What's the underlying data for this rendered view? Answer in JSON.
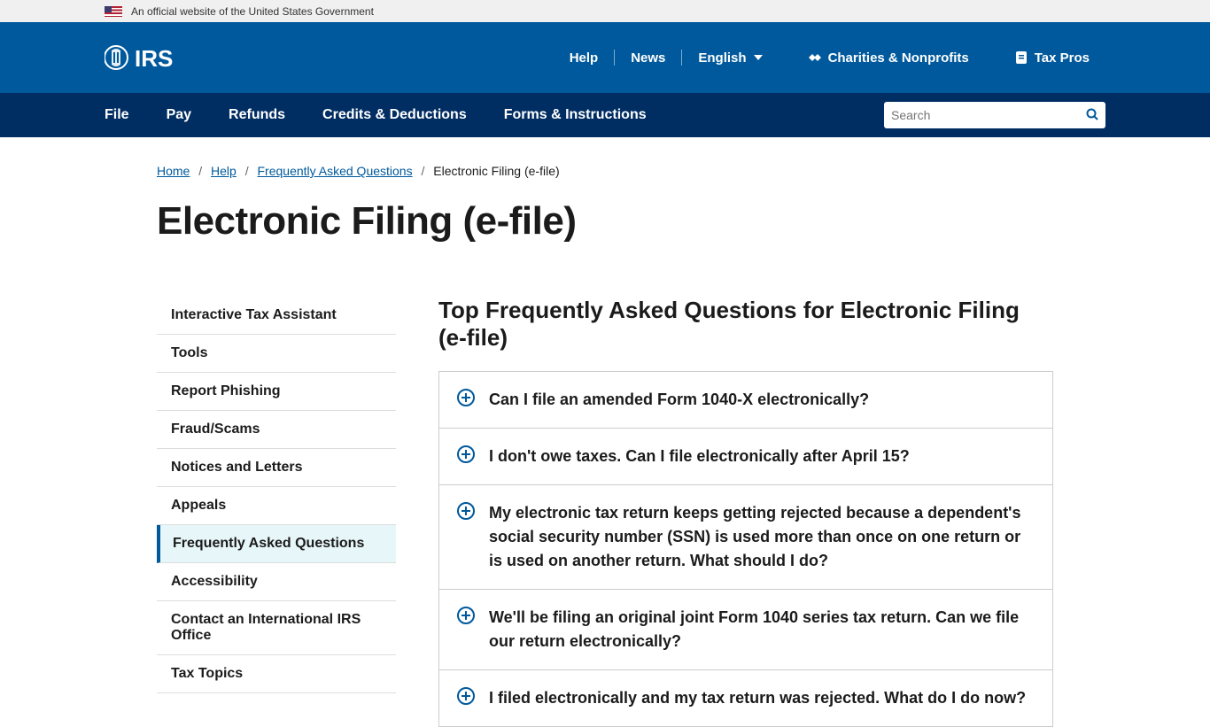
{
  "gov_banner": "An official website of the United States Government",
  "top_links": {
    "help": "Help",
    "news": "News",
    "language": "English",
    "charities": "Charities & Nonprofits",
    "taxpros": "Tax Pros"
  },
  "nav": [
    "File",
    "Pay",
    "Refunds",
    "Credits & Deductions",
    "Forms & Instructions"
  ],
  "search_placeholder": "Search",
  "breadcrumb": {
    "items": [
      "Home",
      "Help",
      "Frequently Asked Questions"
    ],
    "current": "Electronic Filing (e-file)"
  },
  "page_title": "Electronic Filing (e-file)",
  "sidebar": [
    "Interactive Tax Assistant",
    "Tools",
    "Report Phishing",
    "Fraud/Scams",
    "Notices and Letters",
    "Appeals",
    "Frequently Asked Questions",
    "Accessibility",
    "Contact an International IRS Office",
    "Tax Topics"
  ],
  "sidebar_active_index": 6,
  "faq_heading": "Top Frequently Asked Questions for Electronic Filing (e-file)",
  "faqs": [
    "Can I file an amended Form 1040-X electronically?",
    "I don't owe taxes. Can I file electronically after April 15?",
    "My electronic tax return keeps getting rejected because a dependent's social security number (SSN) is used more than once on one return or is used on another return. What should I do?",
    "We'll be filing an original joint Form 1040 series tax return. Can we file our return electronically?",
    "I filed electronically and my tax return was rejected. What do I do now?"
  ]
}
